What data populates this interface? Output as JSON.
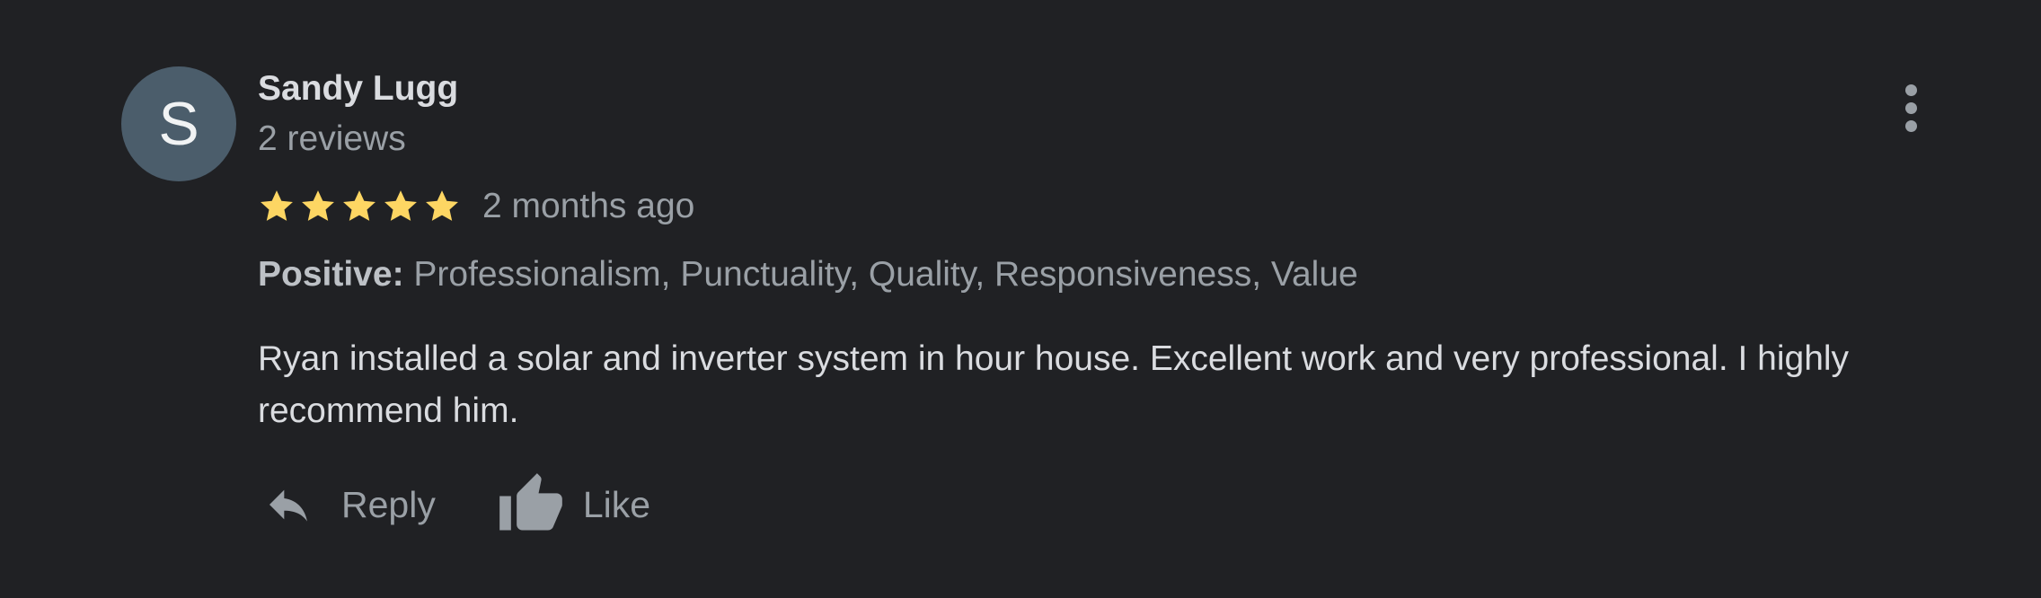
{
  "review": {
    "avatar_letter": "S",
    "author_name": "Sandy Lugg",
    "review_count": "2 reviews",
    "rating": 5,
    "rating_max": 5,
    "time_ago": "2 months ago",
    "attributes_label": "Positive:",
    "attributes_values": "Professionalism, Punctuality, Quality, Responsiveness, Value",
    "text": "Ryan installed a solar and inverter system in hour house. Excellent work and very professional. I highly recommend him."
  },
  "actions": {
    "reply_label": "Reply",
    "like_label": "Like"
  },
  "colors": {
    "background": "#202124",
    "avatar": "#4b5d6b",
    "star": "#fdd663",
    "secondary_text": "#9aa0a6"
  },
  "icons": {
    "more": "more-vertical-icon",
    "star": "star-icon",
    "reply": "reply-icon",
    "like": "thumb-up-icon"
  }
}
